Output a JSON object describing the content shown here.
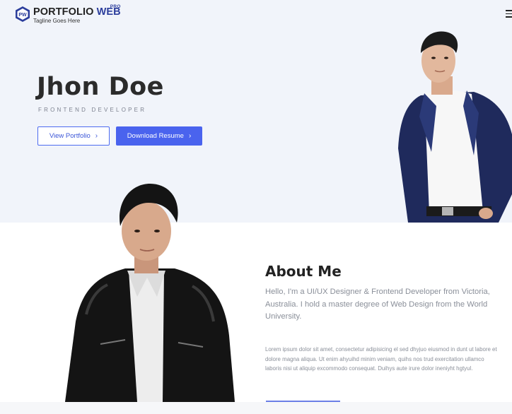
{
  "logo": {
    "name_part1": "PORTFOLIO",
    "name_part2": "WEB",
    "badge": "PRO",
    "tagline": "Tagline Goes Here",
    "mark_letters": "PW",
    "icon": "hexagon-logo-icon"
  },
  "nav": {
    "menu_icon": "hamburger-menu-icon"
  },
  "hero": {
    "name": "Jhon Doe",
    "role": "FRONTEND DEVELOPER",
    "buttons": [
      {
        "label": "View Portfolio",
        "icon": "chevron-right-icon"
      },
      {
        "label": "Download Resume",
        "icon": "chevron-right-icon"
      }
    ],
    "image": "man-in-blue-suit-photo"
  },
  "about": {
    "title": "About Me",
    "intro": "Hello, I'm a UI/UX Designer & Frontend Developer from Victoria, Australia. I hold a master degree of Web Design from the World University.",
    "body": "Lorem ipsum dolor sit amet, consectetur adipisicing el sed dhyjuo eiusmod in dunt ut labore et dolore magna aliqua. Ut enim ahyuihd minim veniam, quihs nos trud exercitation ullamco laboris nisi ut aliquip excommodo consequat. Duihys aute irure dolor ineniyht hgtyul.",
    "image": "man-in-leather-jacket-photo"
  },
  "colors": {
    "accent": "#4a63ee",
    "hero_bg": "#f1f4fa",
    "heading": "#2b2b2b",
    "muted_text": "#8a8f99"
  }
}
